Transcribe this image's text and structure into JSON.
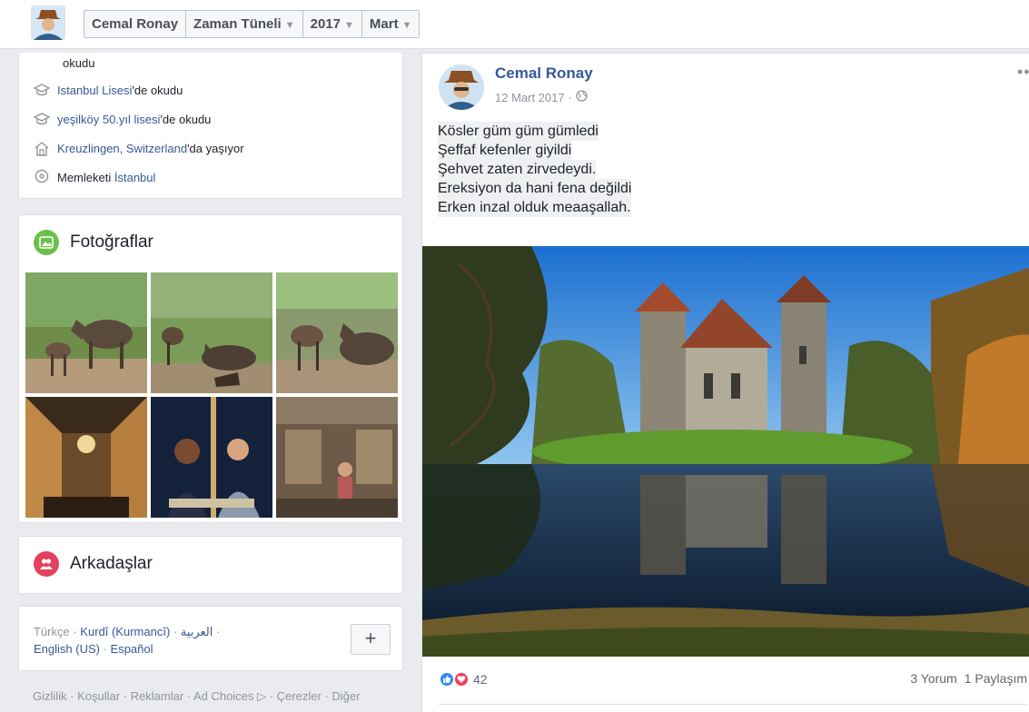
{
  "topbar": {
    "profile_name": "Cemal Ronay",
    "crumbs": [
      {
        "label": "Zaman Tüneli"
      },
      {
        "label": "2017"
      },
      {
        "label": "Mart"
      }
    ]
  },
  "intro": {
    "partial_line": "okudu",
    "items": [
      {
        "icon": "school-icon",
        "link": "Istanbul Lisesi",
        "suffix": "'de okudu"
      },
      {
        "icon": "school-icon",
        "link": "yeşilköy 50.yıl lisesi",
        "suffix": "'de okudu"
      },
      {
        "icon": "home-icon",
        "link": "Kreuzlingen, Switzerland",
        "suffix": "'da yaşıyor"
      },
      {
        "icon": "location-pin-icon",
        "prefix": "Memleketi ",
        "link": "İstanbul"
      }
    ]
  },
  "photos": {
    "title": "Fotoğraflar",
    "count": 6
  },
  "friends": {
    "title": "Arkadaşlar"
  },
  "languages": {
    "current": "Türkçe",
    "sep": " · ",
    "options": [
      "Kurdî (Kurmancî)",
      "العربية",
      "English (US)",
      "Español"
    ],
    "add_label": "+"
  },
  "footer": {
    "links": [
      "Gizlilik",
      "Koşullar",
      "Reklamlar",
      "Ad Choices",
      "Çerezler",
      "Diğer"
    ]
  },
  "post": {
    "author": "Cemal Ronay",
    "date": "12 Mart 2017",
    "more": "•••",
    "lines": [
      "Kösler güm güm gümledi",
      "Şeffaf kefenler giyildi",
      "Şehvet zaten zirvedeydi.",
      "Ereksiyon da hani fena değildi",
      "Erken inzal olduk meaaşallah."
    ],
    "reaction_count": "42",
    "comments": "3 Yorum",
    "shares": "1 Paylaşım"
  },
  "colors": {
    "link": "#365899",
    "photos_icon": "#6bc04b",
    "friends_icon": "#e4405f",
    "like": "#2d88ff",
    "love": "#f33e58"
  }
}
